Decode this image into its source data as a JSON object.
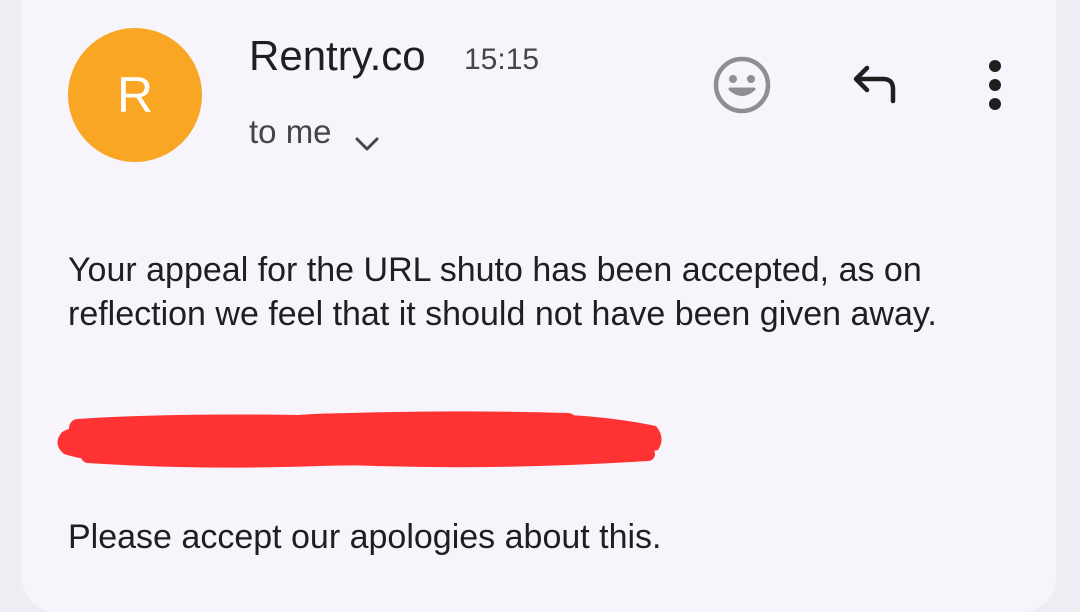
{
  "email": {
    "avatar_letter": "R",
    "sender_name": "Rentry.co",
    "time": "15:15",
    "recipient": "to me",
    "body_paragraph_1": "Your appeal for the URL shuto has been accepted, as on reflection we feel that it should not have been given away.",
    "body_paragraph_2": "Please accept our apologies about this.",
    "redaction_color": "#ff3333"
  },
  "actions": {
    "react_icon": "smiley-face-icon",
    "reply_icon": "reply-icon",
    "more_icon": "more-vertical-icon",
    "expand_icon": "chevron-down-icon"
  },
  "colors": {
    "avatar": "#f8a623",
    "background": "#f7f5fb",
    "text": "#1f1f1f",
    "secondary_text": "#444746"
  }
}
